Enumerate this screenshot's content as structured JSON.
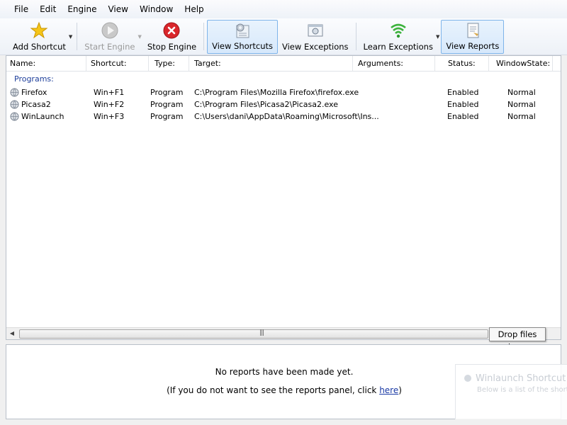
{
  "menu": [
    "File",
    "Edit",
    "Engine",
    "View",
    "Window",
    "Help"
  ],
  "toolbar": {
    "add_shortcut": "Add Shortcut",
    "start_engine": "Start Engine",
    "stop_engine": "Stop Engine",
    "view_shortcuts": "View Shortcuts",
    "view_exceptions": "View Exceptions",
    "learn_exceptions": "Learn Exceptions",
    "view_reports": "View Reports"
  },
  "columns": {
    "name": "Name:",
    "shortcut": "Shortcut:",
    "type": "Type:",
    "target": "Target:",
    "arguments": "Arguments:",
    "status": "Status:",
    "window_state": "WindowState:"
  },
  "group_label": "Programs:",
  "rows": [
    {
      "name": "Firefox",
      "shortcut": "Win+F1",
      "type": "Program",
      "target": "C:\\Program Files\\Mozilla Firefox\\firefox.exe",
      "status": "Enabled",
      "window_state": "Normal"
    },
    {
      "name": "Picasa2",
      "shortcut": "Win+F2",
      "type": "Program",
      "target": "C:\\Program Files\\Picasa2\\Picasa2.exe",
      "status": "Enabled",
      "window_state": "Normal"
    },
    {
      "name": "WinLaunch",
      "shortcut": "Win+F3",
      "type": "Program",
      "target": "C:\\Users\\dani\\AppData\\Roaming\\Microsoft\\Ins...",
      "status": "Enabled",
      "window_state": "Normal"
    }
  ],
  "drop_tip": "Drop files here",
  "reports": {
    "empty_message": "No reports have been made yet.",
    "hint_prefix": "(If you do not want to see the reports panel, click ",
    "hint_link": "here",
    "hint_suffix": ")"
  },
  "notification": {
    "title": "Winlaunch Shortcut",
    "body": "Below is a list of the shortc"
  },
  "colors": {
    "group_label": "#1e3f9b",
    "link": "#1a3aa5",
    "active_button_border": "#7eb4ea"
  }
}
